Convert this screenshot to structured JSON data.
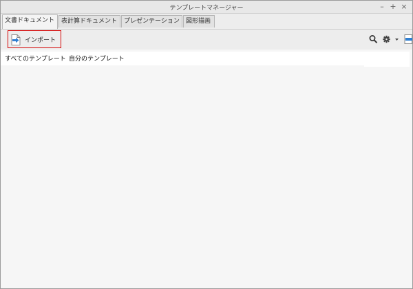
{
  "window": {
    "title": "テンプレートマネージャー",
    "controls": {
      "minimize": "–",
      "maximize": "+",
      "close": "×"
    }
  },
  "tabs": [
    {
      "label": "文書ドキュメント",
      "active": true
    },
    {
      "label": "表計算ドキュメント",
      "active": false
    },
    {
      "label": "プレゼンテーション",
      "active": false
    },
    {
      "label": "図形描画",
      "active": false
    }
  ],
  "toolbar": {
    "import_label": "インポート",
    "icons": [
      "import-icon",
      "search-icon",
      "gear-icon",
      "chevron-down-icon",
      "export-icon"
    ]
  },
  "folders": [
    {
      "label": "すべてのテンプレート"
    },
    {
      "label": "自分のテンプレート"
    }
  ],
  "colors": {
    "highlight": "#d40000",
    "icon_blue": "#2f7fd2"
  }
}
